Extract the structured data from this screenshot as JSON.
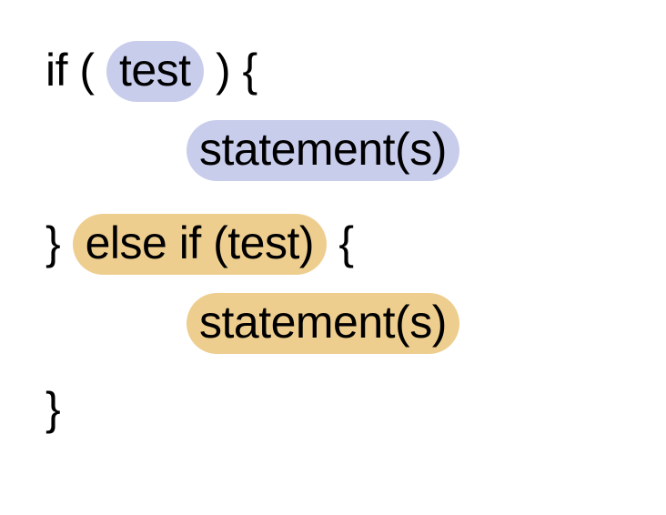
{
  "line1": {
    "keyword_if": "if",
    "open_paren": "(",
    "test_label": "test",
    "close_paren": ")",
    "open_brace": "{"
  },
  "line2": {
    "statements_label": "statement(s)"
  },
  "line3": {
    "close_brace": "}",
    "else_if_label": "else if (test)",
    "open_brace": "{"
  },
  "line4": {
    "statements_label": "statement(s)"
  },
  "line5": {
    "close_brace": "}"
  },
  "colors": {
    "highlight_blue": "#c9cdec",
    "highlight_gold": "#eece8f"
  }
}
